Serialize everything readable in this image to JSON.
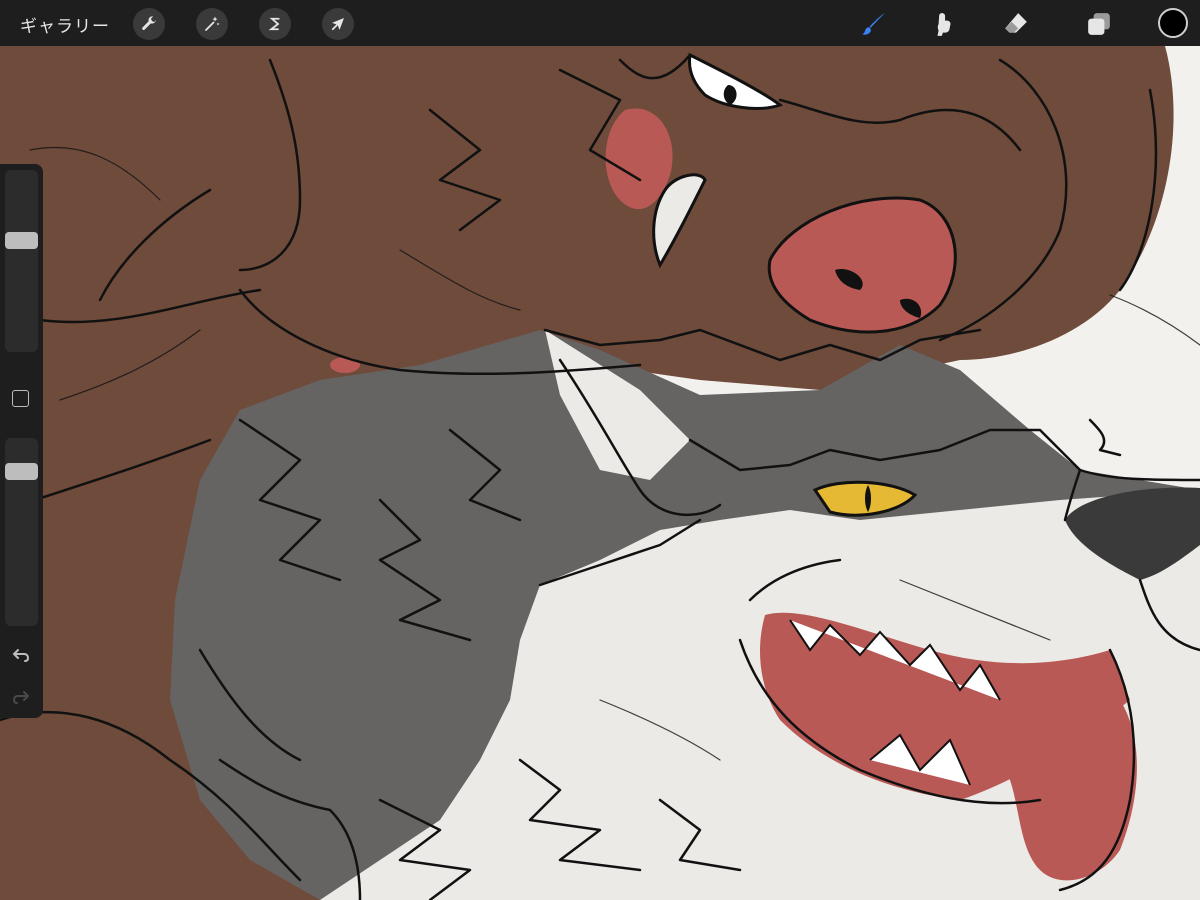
{
  "app": {
    "gallery_label": "ギャラリー"
  },
  "toolbar": {
    "left_tools": [
      {
        "name": "actions",
        "icon": "wrench-icon"
      },
      {
        "name": "adjustments",
        "icon": "magic-wand-icon"
      },
      {
        "name": "selection",
        "icon": "selection-s-icon"
      },
      {
        "name": "transform",
        "icon": "arrow-cursor-icon"
      }
    ],
    "right_tools": [
      {
        "name": "brush",
        "icon": "brush-icon",
        "active": true
      },
      {
        "name": "smudge",
        "icon": "smudge-finger-icon",
        "active": false
      },
      {
        "name": "eraser",
        "icon": "eraser-icon",
        "active": false
      },
      {
        "name": "layers",
        "icon": "layers-icon",
        "active": false
      }
    ],
    "current_color": "#000000",
    "active_tool_color": "#3b82f6"
  },
  "sidebar": {
    "brush_size_level": 0.63,
    "opacity_level": 0.87,
    "modify_button": "square-icon",
    "undo": "undo-arrow-icon",
    "redo": "redo-arrow-icon"
  },
  "canvas": {
    "palette": {
      "brown_fur": "#6e4b3b",
      "gray_fur": "#666463",
      "white_fur": "#eceae6",
      "tongue_red": "#b95956",
      "eye_yellow": "#e6b935",
      "nose_dark": "#3a3a3a",
      "paper": "#f3f1ed"
    }
  }
}
